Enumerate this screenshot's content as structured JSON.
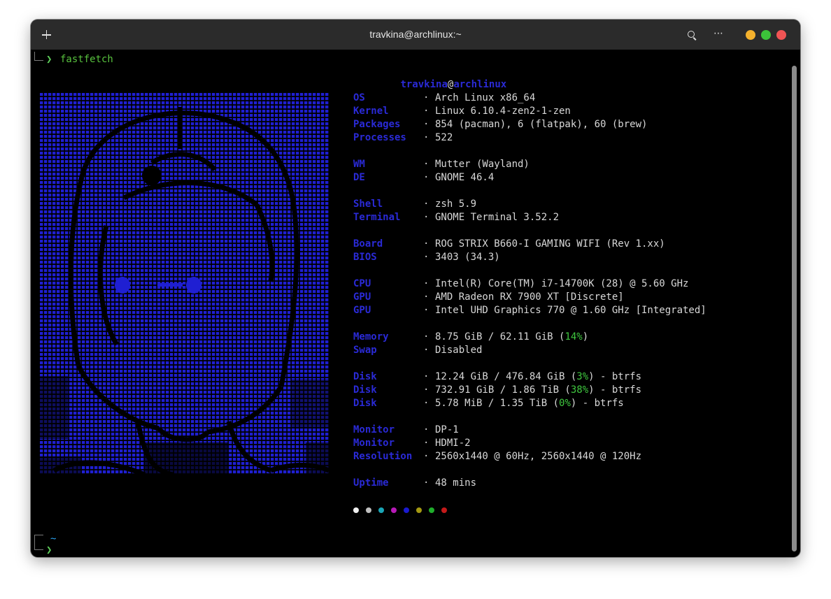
{
  "window": {
    "title": "travkina@archlinux:~",
    "menu_glyph": "⋯",
    "controls": {
      "minimize": "#f4b12d",
      "maximize": "#3cc23a",
      "close": "#f05454"
    }
  },
  "terminal": {
    "prompt_arrow": "❯",
    "command": "fastfetch",
    "cwd": "~",
    "accent": "#2a2ad6",
    "logo_color": "#1a1ac8"
  },
  "info": {
    "user": "travkina",
    "at": "@",
    "host": "archlinux",
    "separator": "·",
    "rows": [
      {
        "key": "OS",
        "value": "Arch Linux x86_64"
      },
      {
        "key": "Kernel",
        "value": "Linux 6.10.4-zen2-1-zen"
      },
      {
        "key": "Packages",
        "value": "854 (pacman), 6 (flatpak), 60 (brew)"
      },
      {
        "key": "Processes",
        "value": "522"
      },
      {
        "key": "WM",
        "value": "Mutter (Wayland)"
      },
      {
        "key": "DE",
        "value": "GNOME 46.4"
      },
      {
        "key": "Shell",
        "value": "zsh 5.9"
      },
      {
        "key": "Terminal",
        "value": "GNOME Terminal 3.52.2"
      },
      {
        "key": "Board",
        "value": "ROG STRIX B660-I GAMING WIFI (Rev 1.xx)"
      },
      {
        "key": "BIOS",
        "value": "3403 (34.3)"
      },
      {
        "key": "CPU",
        "value": "Intel(R) Core(TM) i7-14700K (28) @ 5.60 GHz"
      },
      {
        "key": "GPU",
        "value": "AMD Radeon RX 7900 XT [Discrete]"
      },
      {
        "key": "GPU",
        "value": "Intel UHD Graphics 770 @ 1.60 GHz [Integrated]"
      },
      {
        "key": "Memory",
        "pre": "8.75 GiB / 62.11 GiB (",
        "pct": "14%",
        "post": ")"
      },
      {
        "key": "Swap",
        "value": "Disabled"
      },
      {
        "key": "Disk",
        "pre": "12.24 GiB / 476.84 GiB (",
        "pct": "3%",
        "post": ") - btrfs"
      },
      {
        "key": "Disk",
        "pre": "732.91 GiB / 1.86 TiB (",
        "pct": "38%",
        "post": ") - btrfs"
      },
      {
        "key": "Disk",
        "pre": "5.78 MiB / 1.35 TiB (",
        "pct": "0%",
        "post": ") - btrfs"
      },
      {
        "key": "Monitor",
        "value": "DP-1"
      },
      {
        "key": "Monitor",
        "value": "HDMI-2"
      },
      {
        "key": "Resolution",
        "value": "2560x1440 @ 60Hz, 2560x1440 @ 120Hz"
      },
      {
        "key": "Uptime",
        "value": "48 mins"
      }
    ],
    "palette": [
      "#f0f0f0",
      "#c0c0c0",
      "#1aa6b7",
      "#b81ab8",
      "#1a1ad0",
      "#a59a12",
      "#1fae2b",
      "#c41a1a"
    ]
  }
}
